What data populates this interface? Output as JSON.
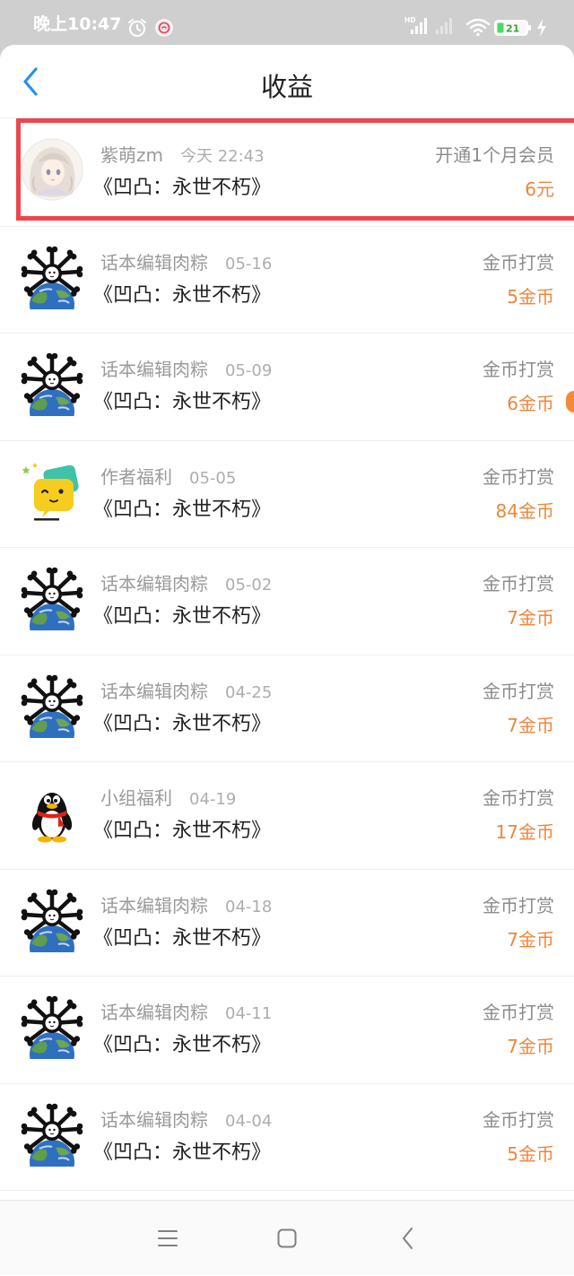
{
  "status_bar": {
    "time": "晚上10:47",
    "network_label": "HD",
    "battery_level": "21",
    "icons": {
      "alarm": "alarm-clock-icon",
      "app": "app-notification-icon",
      "signal": "cellular-signal-icon",
      "signal_secondary": "cellular-signal-weak-icon",
      "wifi": "wifi-icon",
      "battery": "battery-icon",
      "charging": "charging-bolt-icon"
    }
  },
  "header": {
    "title": "收益",
    "back_icon": "chevron-left-icon"
  },
  "entries": [
    {
      "avatar": "anime-girl-avatar",
      "name": "紫萌zm",
      "date": "今天 22:43",
      "type": "开通1个月会员",
      "title": "《凹凸：永世不朽》",
      "amount": "6元",
      "highlighted": true
    },
    {
      "avatar": "globe-spikes-avatar",
      "name": "话本编辑肉粽",
      "date": "05-16",
      "type": "金币打赏",
      "title": "《凹凸：永世不朽》",
      "amount": "5金币"
    },
    {
      "avatar": "globe-spikes-avatar",
      "name": "话本编辑肉粽",
      "date": "05-09",
      "type": "金币打赏",
      "title": "《凹凸：永世不朽》",
      "amount": "6金币"
    },
    {
      "avatar": "yellow-chat-face-avatar",
      "name": "作者福利",
      "date": "05-05",
      "type": "金币打赏",
      "title": "《凹凸：永世不朽》",
      "amount": "84金币"
    },
    {
      "avatar": "globe-spikes-avatar",
      "name": "话本编辑肉粽",
      "date": "05-02",
      "type": "金币打赏",
      "title": "《凹凸：永世不朽》",
      "amount": "7金币"
    },
    {
      "avatar": "globe-spikes-avatar",
      "name": "话本编辑肉粽",
      "date": "04-25",
      "type": "金币打赏",
      "title": "《凹凸：永世不朽》",
      "amount": "7金币"
    },
    {
      "avatar": "qq-penguin-avatar",
      "name": "小组福利",
      "date": "04-19",
      "type": "金币打赏",
      "title": "《凹凸：永世不朽》",
      "amount": "17金币"
    },
    {
      "avatar": "globe-spikes-avatar",
      "name": "话本编辑肉粽",
      "date": "04-18",
      "type": "金币打赏",
      "title": "《凹凸：永世不朽》",
      "amount": "7金币"
    },
    {
      "avatar": "globe-spikes-avatar",
      "name": "话本编辑肉粽",
      "date": "04-11",
      "type": "金币打赏",
      "title": "《凹凸：永世不朽》",
      "amount": "7金币"
    },
    {
      "avatar": "globe-spikes-avatar",
      "name": "话本编辑肉粽",
      "date": "04-04",
      "type": "金币打赏",
      "title": "《凹凸：永世不朽》",
      "amount": "5金币"
    }
  ],
  "nav_bar": {
    "menu_icon": "menu-lines-icon",
    "home_icon": "home-square-icon",
    "back_icon": "back-chevron-icon"
  },
  "colors": {
    "accent": "#2b8df2",
    "amount": "#f0853a",
    "highlight": "#ef454d",
    "status_bar_bg": "#cfcfcf",
    "edge_tab": "#f28a3a"
  }
}
